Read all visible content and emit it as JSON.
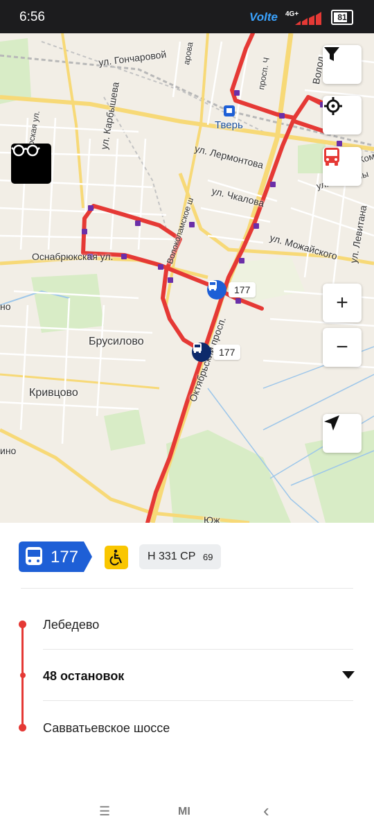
{
  "status_bar": {
    "time": "6:56",
    "volte_label": "Volte",
    "network_label": "4G+",
    "battery_level_percent": 80,
    "battery_text": "81"
  },
  "map": {
    "labels": {
      "gonchatovoy": "ул. Гончаровой",
      "tver": "Тверь",
      "lermontova": "ул. Лермонтова",
      "chkalova": "ул. Чкалова",
      "mozhayskogo": "ул. Можайского",
      "osnabryukskaya": "Оснабрюкская ул.",
      "karbysheva": "ул. Карбышева",
      "volokolamskoe": "Волоколамское ш",
      "oktyabrsky": "Октябрьский просп.",
      "brusilovo": "Брусилово",
      "krivtsovo": "Кривцово",
      "levitana": "ул. Левитана",
      "kominterna": "ул. Коминтерна",
      "kommuny": "ул. Коммуны",
      "tverskaya": "Тверская ул.",
      "yuzhny": "Юж",
      "volod": "Волод",
      "prosp_ch": "просп. Ч",
      "zharova": "арова",
      "edge_ino": "ино",
      "edge_no": "но"
    },
    "vehicles": [
      {
        "route": "177",
        "color": "#1e5fd6"
      },
      {
        "route": "177",
        "color": "#0d2a6b"
      }
    ],
    "route_color": "#e53935",
    "buttons": {
      "filter_icon": "filter-icon",
      "locate_icon": "crosshair-icon",
      "transport_icon": "bus-icon",
      "zoom_in_label": "+",
      "zoom_out_label": "−",
      "navigate_icon": "navigation-arrow-icon",
      "accessibility_icon": "glasses-icon"
    }
  },
  "panel": {
    "route_number": "177",
    "route_color": "#1e5fd6",
    "accessible_icon": "wheelchair-icon",
    "plate_number": "Н 331 СР",
    "plate_region": "69",
    "stops": {
      "start": "Лебедево",
      "count": "48 остановок",
      "end": "Савватьевское шоссе"
    }
  },
  "nav_bar": {
    "menu": "☰",
    "home": "MI",
    "back": "‹"
  }
}
